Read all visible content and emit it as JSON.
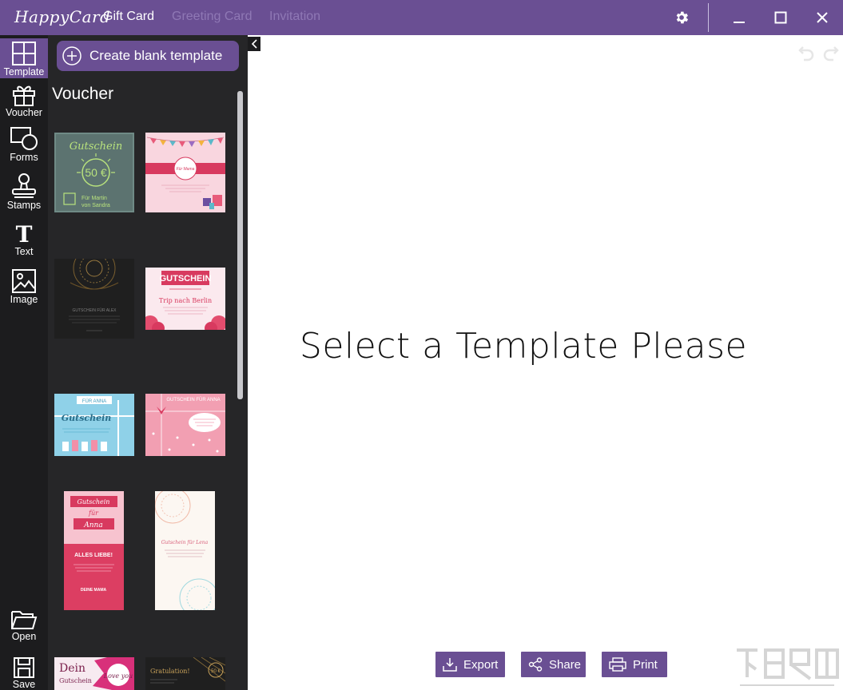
{
  "app": {
    "logo_text": "HappyCard"
  },
  "tabs": [
    {
      "label": "Gift Card",
      "active": true
    },
    {
      "label": "Greeting Card",
      "active": false
    },
    {
      "label": "Invitation",
      "active": false
    }
  ],
  "rail": {
    "items": [
      {
        "label": "Template",
        "icon": "grid-icon",
        "active": true
      },
      {
        "label": "Voucher",
        "icon": "gift-icon",
        "active": false
      },
      {
        "label": "Forms",
        "icon": "shapes-icon",
        "active": false
      },
      {
        "label": "Stamps",
        "icon": "stamp-icon",
        "active": false
      },
      {
        "label": "Text",
        "icon": "text-icon",
        "active": false
      },
      {
        "label": "Image",
        "icon": "image-icon",
        "active": false
      }
    ],
    "bottom": [
      {
        "label": "Open",
        "icon": "folder-open-icon"
      },
      {
        "label": "Save",
        "icon": "save-icon"
      }
    ]
  },
  "panel": {
    "create_label": "Create blank template",
    "section_title": "Voucher",
    "thumbnails": [
      {
        "name": "gutschein-50",
        "t1": "Gutschein",
        "t2": "50 €",
        "t3": "Für Martin",
        "t4": "von Sandra"
      },
      {
        "name": "bunting-pink",
        "t1": "Für Mama"
      },
      {
        "name": "dark-mandala",
        "t1": "GUTSCHEIN FÜR ALEX"
      },
      {
        "name": "berlin-trip",
        "t1": "GUTSCHEIN",
        "t2": "Trip nach Berlin"
      },
      {
        "name": "blue-gutschein",
        "t1": "FÜR ANNA",
        "t2": "Gutschein"
      },
      {
        "name": "pink-dots",
        "t1": "GUTSCHEIN FÜR ANNA"
      },
      {
        "name": "anna-liebe",
        "t1": "Gutschein",
        "t2": "für",
        "t3": "Anna",
        "t4": "ALLES LIEBE!",
        "t5": "DEINE MAMA"
      },
      {
        "name": "lena-mandala",
        "t1": "Gutschein für Lena"
      },
      {
        "name": "dein-gutschein",
        "t1": "Dein",
        "t2": "Gutschein",
        "t3": "Love you"
      },
      {
        "name": "gratulation",
        "t1": "Gratulation!",
        "t2": "50 €"
      }
    ]
  },
  "canvas": {
    "placeholder": "Select a Template Please"
  },
  "actions": {
    "export": "Export",
    "share": "Share",
    "print": "Print"
  },
  "colors": {
    "accent": "#6a4f93",
    "rail": "#1c1c1e",
    "panel": "#262628"
  }
}
